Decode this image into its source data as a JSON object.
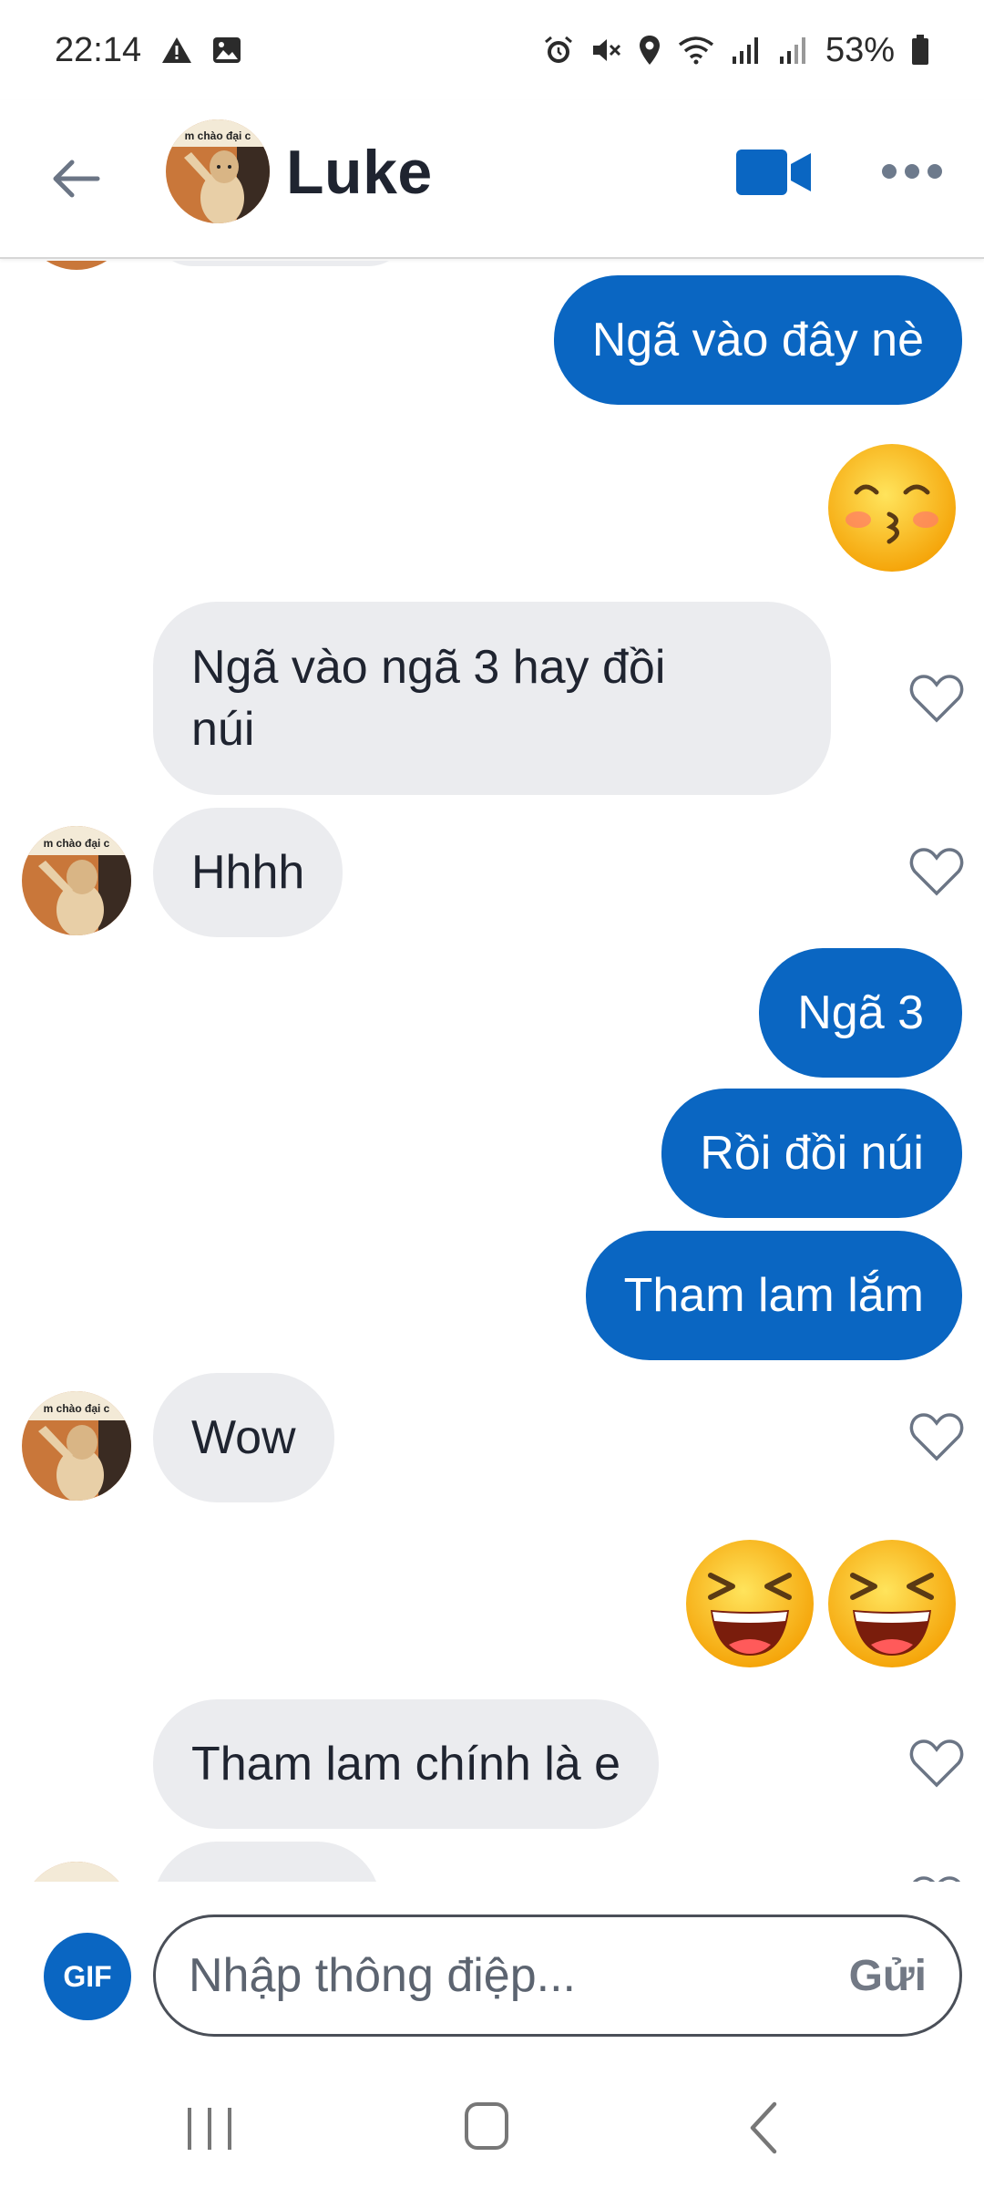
{
  "status_bar": {
    "time": "22:14",
    "battery": "53%"
  },
  "header": {
    "contact_name": "Luke",
    "avatar_caption": "m chào đại c"
  },
  "messages": {
    "out_1": "Ngã vào đây nè",
    "emoji_1": "kissing-face-emoji",
    "in_1": "Ngã vào ngã 3 hay đồi núi",
    "in_1_line1": "Ngã vào ngã 3 hay đồi",
    "in_1_line2": "núi",
    "in_2": "Hhhh",
    "out_2": "Ngã 3",
    "out_3": "Rồi đồi núi",
    "out_4": "Tham lam lắm",
    "in_3": "Wow",
    "emoji_2": "laughing-face-emoji",
    "in_4": "Tham lam chính là e"
  },
  "composer": {
    "gif_label": "GIF",
    "placeholder": "Nhập thông điệp...",
    "send_label": "Gửi"
  },
  "colors": {
    "outgoing_bubble": "#0a66c2",
    "incoming_bubble": "#ebecef",
    "accent": "#0a66c2"
  }
}
